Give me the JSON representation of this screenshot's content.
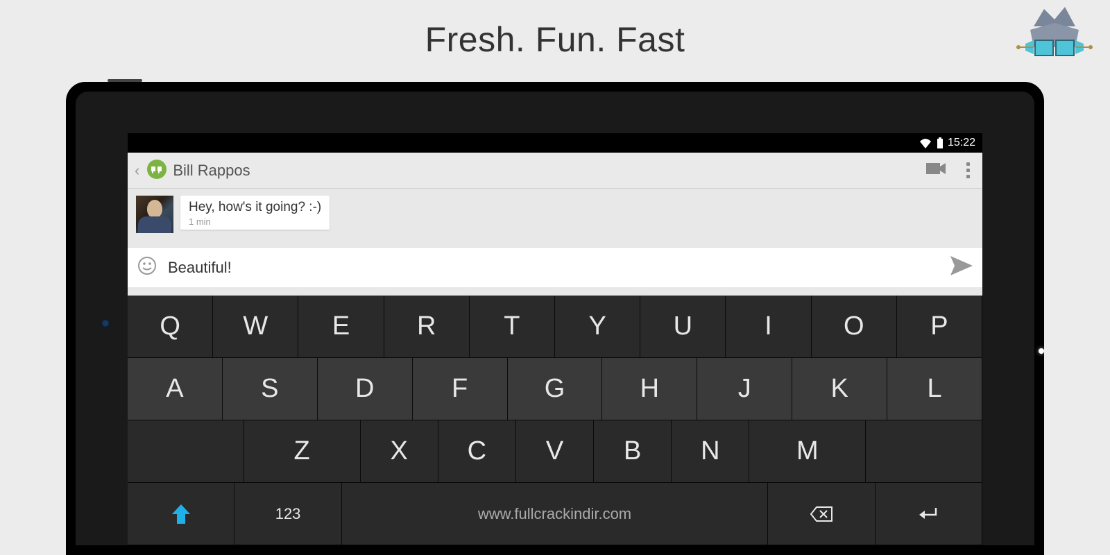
{
  "tagline": "Fresh. Fun. Fast",
  "status": {
    "time": "15:22"
  },
  "header": {
    "contact_name": "Bill Rappos"
  },
  "message": {
    "text": "Hey, how's it going? :-)",
    "time": "1 min"
  },
  "compose": {
    "value": "Beautiful!"
  },
  "keyboard": {
    "row1": [
      "Q",
      "W",
      "E",
      "R",
      "T",
      "Y",
      "U",
      "I",
      "O",
      "P"
    ],
    "row2": [
      "A",
      "S",
      "D",
      "F",
      "G",
      "H",
      "J",
      "K",
      "L"
    ],
    "row3": [
      "Z",
      "X",
      "C",
      "V",
      "B",
      "N",
      "M"
    ],
    "numkey": "123",
    "space_label": "www.fullcrackindir.com"
  }
}
